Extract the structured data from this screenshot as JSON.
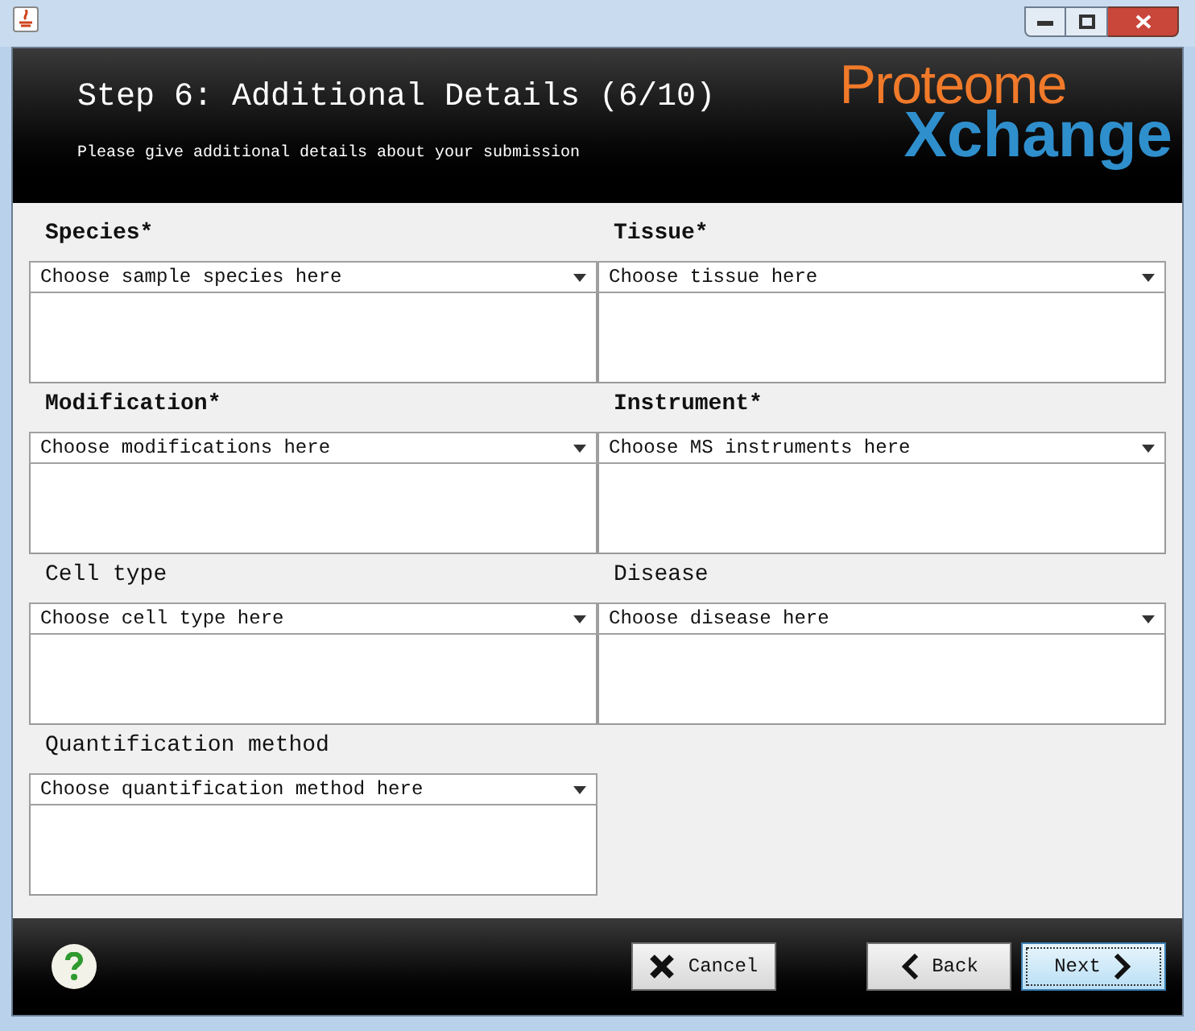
{
  "header": {
    "title": "Step 6: Additional Details (6/10)",
    "subtitle": "Please give additional details about your submission",
    "logo": {
      "top": "Proteome",
      "bottom": "Xchange"
    }
  },
  "fields": [
    {
      "label": "Species*",
      "required": true,
      "placeholder": "Choose sample species here"
    },
    {
      "label": "Tissue*",
      "required": true,
      "placeholder": "Choose tissue here"
    },
    {
      "label": "Modification*",
      "required": true,
      "placeholder": "Choose modifications here"
    },
    {
      "label": "Instrument*",
      "required": true,
      "placeholder": "Choose MS instruments here"
    },
    {
      "label": "Cell type",
      "required": false,
      "placeholder": "Choose cell type here"
    },
    {
      "label": "Disease",
      "required": false,
      "placeholder": "Choose disease here"
    },
    {
      "label": "Quantification method",
      "required": false,
      "placeholder": "Choose quantification method here"
    }
  ],
  "buttons": [
    {
      "kind": "cancel",
      "label": "Cancel",
      "focused": false
    },
    {
      "kind": "back",
      "label": "Back",
      "focused": false
    },
    {
      "kind": "next",
      "label": "Next",
      "focused": true
    }
  ]
}
